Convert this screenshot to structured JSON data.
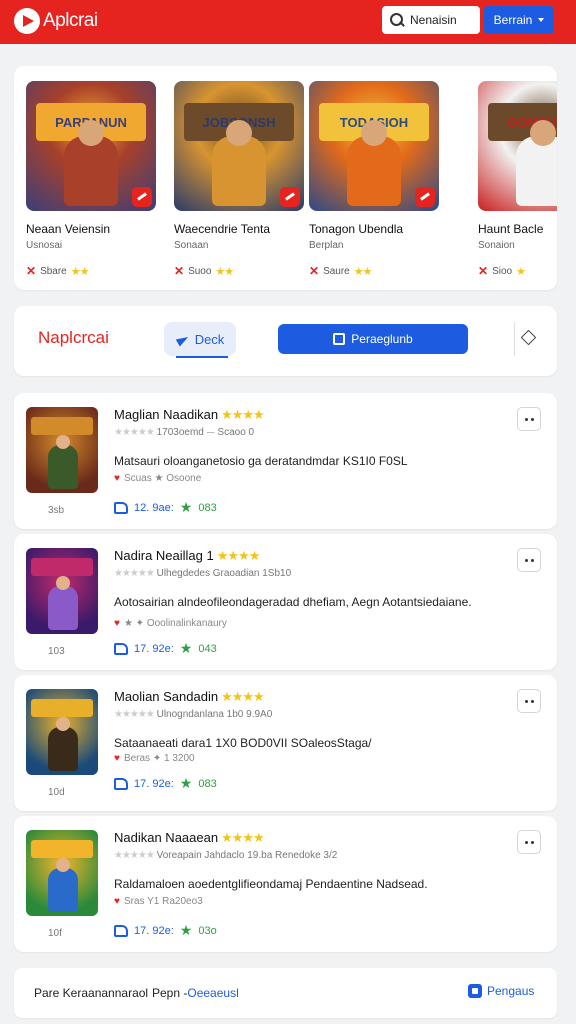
{
  "app": {
    "name": "Aplcrai",
    "brand_color": "#e52420",
    "accent_color": "#1d5ce0"
  },
  "header": {
    "search_placeholder": "Nenaisin",
    "button_label": "Berrain"
  },
  "featured": [
    {
      "art_title": "PARPANUN",
      "title": "Neaan Veiensin",
      "subtitle": "Usnosai",
      "score": "Sbare",
      "stars": "★★",
      "colors": [
        "#3a3f7a",
        "#a8402a",
        "#f0a830"
      ]
    },
    {
      "art_title": "JOBSONSH",
      "title": "Waecendrie Tenta",
      "subtitle": "Sonaan",
      "score": "Suoo",
      "stars": "★★",
      "colors": [
        "#2a3b6a",
        "#d89430",
        "#6c4a2a"
      ]
    },
    {
      "art_title": "TODASIOH",
      "title": "Tonagon Ubendla",
      "subtitle": "Berplan",
      "score": "Saure",
      "stars": "★★",
      "colors": [
        "#2c4a88",
        "#e26a1a",
        "#f2c23a"
      ]
    },
    {
      "art_title": "GOMSUNNI",
      "title": "Haunt Bacle",
      "subtitle": "Sonaion",
      "score": "Sioo",
      "stars": "★",
      "colors": [
        "#c81e1e",
        "#f2f2f2",
        "#6a4a2a"
      ]
    }
  ],
  "tabs": {
    "title": "Naplcrcai",
    "tab1": "Deck",
    "tab2": "Peraeglunb"
  },
  "list": [
    {
      "title": "Maglian Naadikan",
      "stars": "★★★★",
      "line2": "1703oemd ⏤ Scaoo 0",
      "desc": "Matsauri oloanganetosio ga deratandmdar KS1I0 F0SL",
      "meta": "Scuas ★ Osoone",
      "count": "3sb",
      "likes": "12. 9ae:",
      "rating": "083",
      "colors": [
        "#6a2a1a",
        "#d28a2a",
        "#3a5a2a"
      ]
    },
    {
      "title": "Nadira Neaillag 1",
      "stars": "★★★★",
      "line2": "Ulhegdedes Graoadian 1Sb10",
      "desc": "Aotosairian alndeofileondageradad dhefiam, Aegn Aotantsiedaiane.",
      "meta": "★ ✦ Ooolinalinkanaury",
      "count": "103",
      "likes": "17. 92e:",
      "rating": "043",
      "colors": [
        "#3a1a6a",
        "#c02a6a",
        "#8a5ac8"
      ]
    },
    {
      "title": "Maolian Sandadin",
      "stars": "★★★★",
      "line2": "Ulnogndanlana 1b0 9.9A0",
      "desc": "Sataanaeati dara1   1X0 BOD0VII SOaleosStaga/",
      "meta": "Beras ✦ 1 3200",
      "count": "10d",
      "likes": "17. 92e:",
      "rating": "083",
      "colors": [
        "#1a4a7a",
        "#e8b02a",
        "#3a2a1a"
      ]
    },
    {
      "title": "Nadikan Naaaean",
      "stars": "★★★★",
      "line2": "Voreapain Jahdaclo 19.ba   Renedoke 3/2",
      "desc": "Raldamaloen aoedentglifieondamaj Pendaentine Nadsead.",
      "meta": "Sras Y1 Ra20eo3",
      "count": "10f",
      "likes": "17. 92e:",
      "rating": "03o",
      "colors": [
        "#2a8a3a",
        "#f2b42a",
        "#2a6ac8"
      ]
    }
  ],
  "footer": {
    "left": "Pare Keraanannaraol",
    "mid_prefix": "Pepn -",
    "mid_link": "Oeeaeusl",
    "right": "Pengaus"
  }
}
